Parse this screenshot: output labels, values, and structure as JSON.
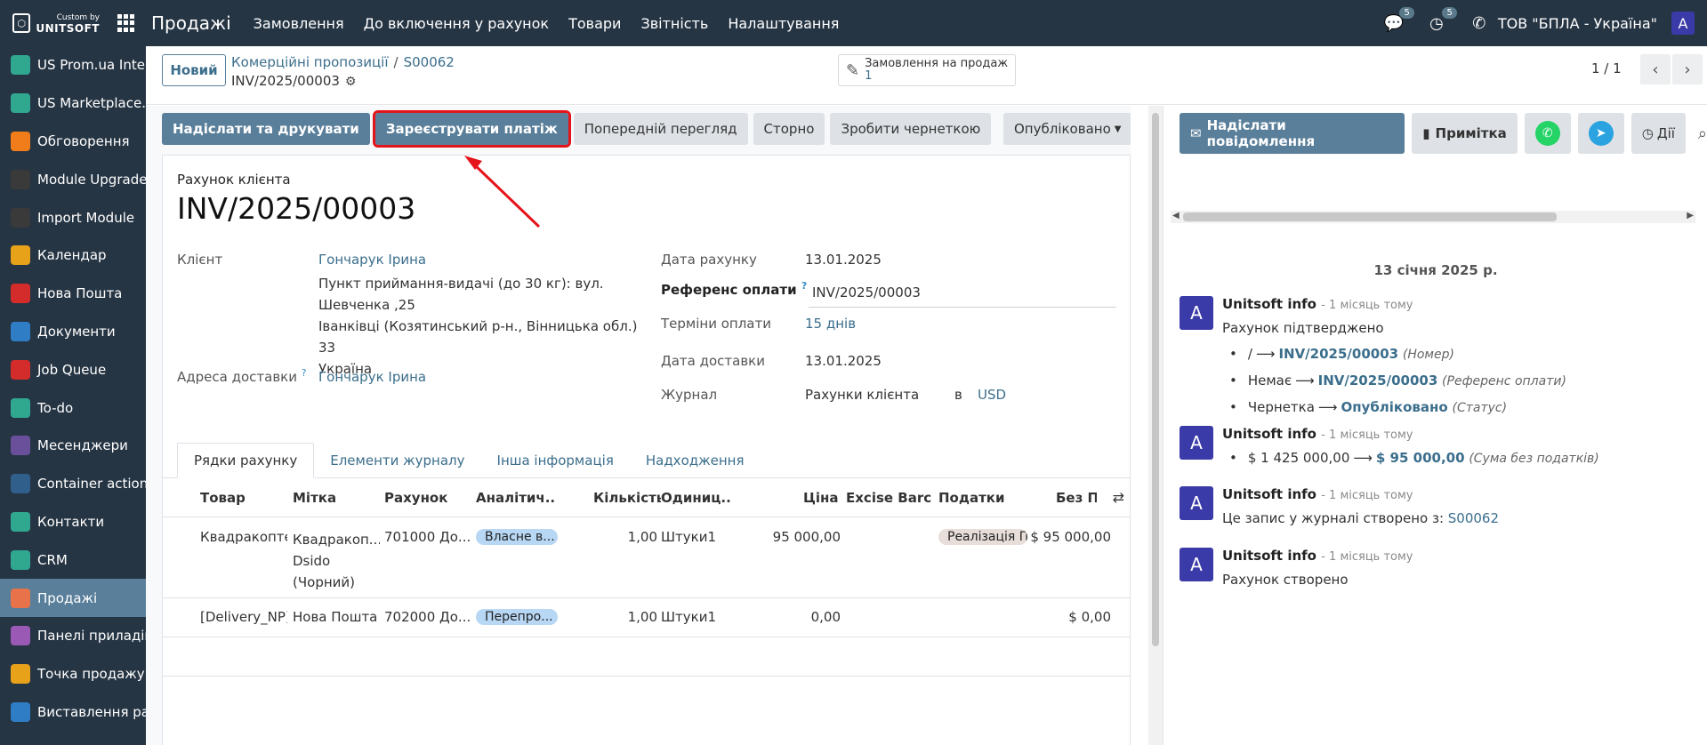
{
  "topbar": {
    "logo_small": "Custom by",
    "logo_big": "UNITSOFT",
    "app_name": "Продажі",
    "menu": [
      "Замовлення",
      "До включення у рахунок",
      "Товари",
      "Звітність",
      "Налаштування"
    ],
    "chat_badge": "5",
    "activity_badge": "5",
    "company": "ТОВ \"БПЛА - Україна\"",
    "user_initial": "A"
  },
  "sidebar": {
    "items": [
      {
        "label": "US Prom.ua Inte...",
        "color": "#2fa88f",
        "icon": "cube-icon"
      },
      {
        "label": "US Marketplace...",
        "color": "#2fa88f",
        "icon": "cube-icon"
      },
      {
        "label": "Обговорення",
        "color": "#f07d1a",
        "icon": "discuss-icon"
      },
      {
        "label": "Module Upgrade",
        "color": "#3a3a3a",
        "icon": "upgrade-icon"
      },
      {
        "label": "Import Module",
        "color": "#3a3a3a",
        "icon": "import-icon"
      },
      {
        "label": "Календар",
        "color": "#e8a21a",
        "icon": "calendar-icon"
      },
      {
        "label": "Нова Пошта",
        "color": "#d42b2b",
        "icon": "nova-poshta-icon"
      },
      {
        "label": "Документи",
        "color": "#2f7ec5",
        "icon": "documents-icon"
      },
      {
        "label": "Job Queue",
        "color": "#d42b2b",
        "icon": "job-queue-icon"
      },
      {
        "label": "To-do",
        "color": "#2fa88f",
        "icon": "todo-icon"
      },
      {
        "label": "Месенджери",
        "color": "#6a4f9a",
        "icon": "messenger-icon"
      },
      {
        "label": "Container actions",
        "color": "#2f5f8a",
        "icon": "container-icon"
      },
      {
        "label": "Контакти",
        "color": "#2fa88f",
        "icon": "contacts-icon"
      },
      {
        "label": "CRM",
        "color": "#2fa88f",
        "icon": "crm-icon"
      },
      {
        "label": "Продажі",
        "color": "#e8734a",
        "icon": "sales-icon",
        "active": true
      },
      {
        "label": "Панелі приладів",
        "color": "#9b59b6",
        "icon": "dashboard-icon"
      },
      {
        "label": "Точка продажу",
        "color": "#e8a21a",
        "icon": "pos-icon"
      },
      {
        "label": "Виставлення ра...",
        "color": "#2f7ec5",
        "icon": "invoicing-icon"
      }
    ]
  },
  "control": {
    "new_label": "Новий",
    "breadcrumb_parent": "Комерційні пропозиції",
    "breadcrumb_order": "S00062",
    "record_name": "INV/2025/00003",
    "smart_label": "Замовлення на продаж",
    "smart_value": "1",
    "pager": "1 / 1"
  },
  "actions": {
    "send_print": "Надіслати та друкувати",
    "register_payment": "Зареєструвати платіж",
    "preview": "Попередній перегляд",
    "reverse": "Сторно",
    "draft": "Зробити чернеткою",
    "state": "Опубліковано"
  },
  "form": {
    "subtitle": "Рахунок клієнта",
    "title": "INV/2025/00003",
    "customer_label": "Клієнт",
    "customer": "Гончарук Ірина",
    "address": [
      "Пункт приймання-видачі (до 30 кг): вул.",
      "Шевченка ,25",
      "Іванківці (Козятинський р-н., Вінницька обл.) 33",
      "Україна"
    ],
    "delivery_label": "Адреса доставки",
    "delivery": "Гончарук Ірина",
    "invoice_date_label": "Дата рахунку",
    "invoice_date": "13.01.2025",
    "payment_ref_label": "Референс оплати",
    "payment_ref": "INV/2025/00003",
    "terms_label": "Терміни оплати",
    "terms": "15 днів",
    "delivery_date_label": "Дата доставки",
    "delivery_date": "13.01.2025",
    "journal_label": "Журнал",
    "journal": "Рахунки клієнта",
    "journal_in": "в",
    "currency": "USD"
  },
  "tabs": [
    "Рядки рахунку",
    "Елементи журналу",
    "Інша інформація",
    "Надходження"
  ],
  "table": {
    "headers": [
      "Товар",
      "Мітка",
      "Рахунок",
      "Аналітич...",
      "Кількість",
      "Одиниц...",
      "Ціна",
      "Excise Barc...",
      "Податки",
      "Без П"
    ],
    "rows": [
      {
        "product": "Квадракоптер",
        "label": [
          "Квадракоп...",
          "Dsido",
          "(Чорний)"
        ],
        "account": "701000 До...",
        "analytic": "Власне в...",
        "qty": "1,00",
        "uom": "Штуки1",
        "price": "95 000,00",
        "tax": "Реалізація П",
        "subtotal": "$ 95 000,00"
      },
      {
        "product": "[Delivery_NP]",
        "label": [
          "Нова Пошта"
        ],
        "account": "702000 До...",
        "analytic": "Перепро...",
        "qty": "1,00",
        "uom": "Штуки1",
        "price": "0,00",
        "tax": "",
        "subtotal": "$ 0,00"
      }
    ]
  },
  "chatter": {
    "send_message": "Надіслати повідомлення",
    "note": "Примітка",
    "activities": "Дії",
    "date": "13 січня 2025 р.",
    "messages": [
      {
        "author": "Unitsoft info",
        "time": "- 1 місяць тому",
        "title": "Рахунок підтверджено",
        "changes": [
          {
            "old": "/",
            "new": "INV/2025/00003",
            "field": "(Номер)"
          },
          {
            "old": "Немає",
            "new": "INV/2025/00003",
            "field": "(Референс оплати)"
          },
          {
            "old": "Чернетка",
            "new": "Опубліковано",
            "field": "(Статус)"
          }
        ]
      },
      {
        "author": "Unitsoft info",
        "time": "- 1 місяць тому",
        "changes": [
          {
            "old": "$ 1 425 000,00",
            "new": "$ 95 000,00",
            "field": "(Сума без податків)"
          }
        ]
      },
      {
        "author": "Unitsoft info",
        "time": "- 1 місяць тому",
        "text": "Це запис у журналі створено з:",
        "link": "S00062"
      },
      {
        "author": "Unitsoft info",
        "time": "- 1 місяць тому",
        "text": "Рахунок створено"
      }
    ]
  },
  "colors": {
    "primary": "#5a7f9a",
    "navbar": "#263544",
    "link": "#3b6e8c",
    "highlight": "#e5141b"
  }
}
